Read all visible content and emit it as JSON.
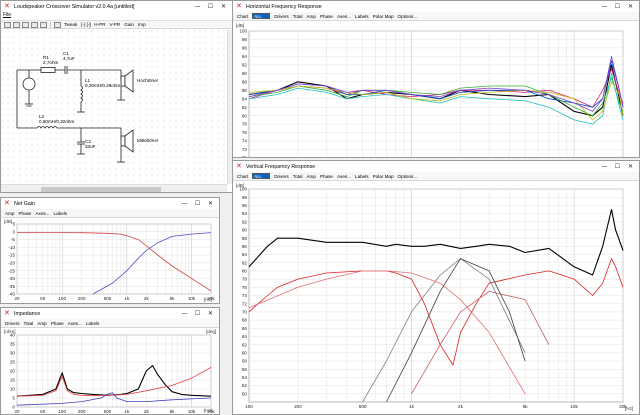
{
  "colors": {
    "accent": "#0b63c5",
    "title_icon": "#d4202a",
    "grid": "#d9d9d9",
    "axis_bg": "#ffffff"
  },
  "circuit_window": {
    "title": "Loudspeaker Crossover Simulator v2.0.4a [untitled]",
    "menu": "File",
    "toolbar": [
      "Tweak",
      "H-PR",
      "V-PR",
      "Gain",
      "Imp"
    ],
    "icons": [
      "new-icon",
      "open-icon",
      "save-icon",
      "undo-icon",
      "redo-icon",
      "tweak-icon"
    ],
    "components": {
      "r1": "R1",
      "r1_val": "2,7ohm",
      "c1": "C1",
      "c1_val": "4,7uF",
      "l1": "L1",
      "l1_val": "0,20mH/0,25ohm",
      "l2": "L2",
      "l2_val": "0,60mH/0,32ohm",
      "c2": "C2",
      "c2_val": "33uF",
      "tweeter": "Hochtöner",
      "mid": "Mitteltöner"
    }
  },
  "net_gain_window": {
    "title": "Net Gain",
    "tabs": [
      "Amp",
      "Phase",
      "Axes...",
      "Labels"
    ],
    "unit_left": "[dB]",
    "unit_bottom": "[Hz]"
  },
  "impedance_window": {
    "title": "Impedance",
    "tabs": [
      "Drivers",
      "Total",
      "Amp",
      "Phase",
      "Axes...",
      "Labels"
    ],
    "unit_left": "[ohm]",
    "unit_right": "[deg]",
    "unit_bottom": "[Hz]"
  },
  "hfr_window": {
    "title": "Horizontal Frequency Response",
    "toolbar": {
      "chart": "Chart",
      "select": "ALL",
      "items": [
        "Drivers",
        "Total",
        "Amp",
        "Phase",
        "Axes...",
        "Labels",
        "Polar Map",
        "Options..."
      ]
    },
    "unit_left": "[dB]"
  },
  "vfr_window": {
    "title": "Vertical Frequency Response",
    "toolbar": {
      "chart": "Chart",
      "select": "ALL",
      "items": [
        "Drivers",
        "Total",
        "Amp",
        "Phase",
        "Axes...",
        "Labels",
        "Polar Map",
        "Options..."
      ]
    },
    "unit_left": "[dB]",
    "unit_bottom": "[Hz]"
  },
  "chart_data": [
    {
      "id": "net_gain",
      "type": "line",
      "xscale": "log",
      "xlim": [
        20,
        20000
      ],
      "ylim": [
        -40,
        5
      ],
      "xticks": [
        "20",
        "50",
        "100",
        "200",
        "500",
        "1k",
        "2k",
        "5k",
        "10k",
        "20k"
      ],
      "yticks": [
        "5",
        "0",
        "-5",
        "-10",
        "-15",
        "-20",
        "-25",
        "-30",
        "-35",
        "-40"
      ],
      "series": [
        {
          "color": "#d04040",
          "x": [
            20,
            50,
            100,
            200,
            500,
            800,
            1000,
            1500,
            2000,
            3000,
            5000,
            10000,
            20000
          ],
          "y": [
            -0.5,
            -0.5,
            -0.5,
            -0.6,
            -1,
            -1.5,
            -2.5,
            -5,
            -9,
            -15,
            -22,
            -30,
            -38
          ]
        },
        {
          "color": "#5050c8",
          "x": [
            300,
            600,
            1000,
            1500,
            2000,
            3000,
            5000,
            10000,
            20000
          ],
          "y": [
            -40,
            -33,
            -25,
            -17,
            -12,
            -7,
            -3,
            -1.5,
            -0.5
          ]
        }
      ]
    },
    {
      "id": "impedance",
      "type": "line",
      "xscale": "log",
      "xlim": [
        20,
        20000
      ],
      "ylim": [
        0,
        40
      ],
      "xticks": [
        "20",
        "50",
        "100",
        "200",
        "500",
        "1k",
        "2k",
        "5k",
        "10k",
        "20k"
      ],
      "yticks": [
        "40",
        "35",
        "30",
        "25",
        "20",
        "15",
        "10",
        "5",
        "0"
      ],
      "series": [
        {
          "color": "#000000",
          "x": [
            20,
            50,
            80,
            100,
            120,
            150,
            200,
            300,
            500,
            800,
            1000,
            1500,
            2000,
            2500,
            3000,
            4000,
            5000,
            7000,
            10000,
            20000
          ],
          "y": [
            6,
            7,
            10,
            19,
            10,
            8,
            7.5,
            7,
            6.5,
            7,
            7.5,
            10,
            20,
            23,
            18,
            12,
            8.5,
            7,
            6.5,
            6
          ]
        },
        {
          "color": "#e04040",
          "x": [
            20,
            50,
            80,
            100,
            120,
            150,
            200,
            300,
            500,
            1000,
            2000,
            5000,
            10000,
            20000
          ],
          "y": [
            6,
            6.5,
            9,
            17,
            9,
            7,
            6.5,
            6.3,
            6.5,
            7,
            9,
            12,
            16,
            22
          ]
        },
        {
          "color": "#4040c0",
          "x": [
            20,
            100,
            200,
            400,
            500,
            600,
            700,
            1000,
            2000,
            5000,
            10000,
            20000
          ],
          "y": [
            1,
            2,
            3,
            5,
            7,
            8,
            5,
            3,
            3,
            4,
            4.5,
            5
          ]
        }
      ]
    },
    {
      "id": "horizontal_fr",
      "type": "line",
      "xscale": "log",
      "xlim": [
        100,
        20000
      ],
      "ylim": [
        70,
        100
      ],
      "yticks": [
        "100",
        "98",
        "96",
        "94",
        "92",
        "90",
        "88",
        "86",
        "84",
        "82",
        "80",
        "78",
        "76",
        "74",
        "72",
        "70"
      ],
      "series": [
        {
          "color": "#000000",
          "x": [
            100,
            150,
            200,
            300,
            400,
            500,
            700,
            1000,
            1500,
            2000,
            3000,
            5000,
            7000,
            10000,
            13000,
            15000,
            17000,
            19000,
            20000
          ],
          "y": [
            85,
            86,
            88,
            87,
            84,
            85,
            85.5,
            85,
            84,
            86,
            85,
            84.5,
            85,
            81,
            80,
            82,
            92,
            84,
            80
          ]
        },
        {
          "color": "#e0207a",
          "x": [
            100,
            150,
            200,
            300,
            400,
            500,
            700,
            1000,
            1500,
            2000,
            3000,
            5000,
            7000,
            10000,
            13000,
            15000,
            17000,
            19000,
            20000
          ],
          "y": [
            84,
            86,
            87,
            86.5,
            85,
            86,
            85,
            84.5,
            85,
            86,
            86,
            85.5,
            86,
            84,
            82,
            86,
            91,
            85,
            83
          ]
        },
        {
          "color": "#0050c0",
          "x": [
            100,
            150,
            200,
            300,
            400,
            500,
            700,
            1000,
            1500,
            2000,
            3000,
            5000,
            7000,
            10000,
            13000,
            15000,
            17000,
            19000,
            20000
          ],
          "y": [
            85,
            86,
            87.5,
            87,
            85,
            85,
            86,
            85,
            84,
            85.5,
            86,
            86,
            84,
            83,
            82,
            84,
            93,
            86,
            82
          ]
        },
        {
          "color": "#30b030",
          "x": [
            100,
            150,
            200,
            300,
            400,
            500,
            700,
            1000,
            1500,
            2000,
            3000,
            5000,
            7000,
            10000,
            13000,
            15000,
            17000,
            19000,
            20000
          ],
          "y": [
            84.5,
            85.5,
            87,
            86,
            84.5,
            86,
            86,
            85.5,
            85,
            86.5,
            87,
            87,
            85,
            82,
            80,
            83,
            89,
            83,
            81
          ]
        },
        {
          "color": "#20c0c0",
          "x": [
            100,
            150,
            200,
            300,
            400,
            500,
            700,
            1000,
            1500,
            2000,
            3000,
            5000,
            7000,
            10000,
            13000,
            15000,
            17000,
            19000,
            20000
          ],
          "y": [
            84,
            85,
            86.5,
            85.5,
            84,
            84.5,
            85,
            84,
            83,
            84.5,
            84,
            83.5,
            82,
            79,
            78,
            80,
            90,
            82,
            79
          ]
        },
        {
          "color": "#c0c020",
          "x": [
            100,
            150,
            200,
            300,
            400,
            500,
            700,
            1000,
            1500,
            2000,
            3000,
            5000,
            7000,
            10000,
            13000,
            15000,
            17000,
            19000,
            20000
          ],
          "y": [
            85.5,
            86,
            87,
            86.5,
            85.5,
            85,
            85.5,
            84,
            83.5,
            85,
            85.5,
            86,
            85.5,
            84,
            79,
            81,
            88,
            85,
            80
          ]
        },
        {
          "color": "#8040d0",
          "x": [
            100,
            150,
            200,
            300,
            400,
            500,
            700,
            1000,
            1500,
            2000,
            3000,
            5000,
            7000,
            10000,
            13000,
            15000,
            17000,
            19000,
            20000
          ],
          "y": [
            84.5,
            86,
            87.5,
            87,
            85.5,
            86,
            86,
            85,
            84.5,
            86,
            86.5,
            86,
            85,
            83,
            81,
            84,
            94,
            86,
            82
          ]
        }
      ]
    },
    {
      "id": "vertical_fr",
      "type": "line",
      "xscale": "log",
      "xlim": [
        100,
        20000
      ],
      "ylim": [
        48,
        100
      ],
      "xticks": [
        "100",
        "200",
        "500",
        "1k",
        "2k",
        "5k",
        "10k",
        "20k"
      ],
      "yticks": [
        "100",
        "98",
        "96",
        "94",
        "92",
        "90",
        "88",
        "86",
        "84",
        "82",
        "80",
        "78",
        "76",
        "74",
        "72",
        "70",
        "68",
        "66",
        "64",
        "62",
        "60",
        "58",
        "56",
        "54",
        "52",
        "50"
      ],
      "series": [
        {
          "color": "#000000",
          "x": [
            100,
            130,
            150,
            200,
            300,
            500,
            700,
            800,
            1000,
            1200,
            1500,
            2000,
            2500,
            3000,
            4000,
            5000,
            7000,
            10000,
            13000,
            15000,
            17000,
            18000,
            20000
          ],
          "y": [
            81,
            86,
            88,
            88,
            87,
            87,
            86,
            86.5,
            86,
            86,
            86.5,
            85.5,
            86,
            86.5,
            86,
            84.5,
            85.5,
            81,
            79,
            86,
            95,
            90,
            85
          ]
        },
        {
          "color": "#e02020",
          "x": [
            100,
            130,
            150,
            200,
            300,
            500,
            700,
            800,
            1000,
            1200,
            1500,
            1800,
            2000,
            2500,
            3000,
            5000,
            7000,
            10000,
            13000,
            15000,
            17000,
            18000,
            20000
          ],
          "y": [
            70,
            74,
            76,
            78,
            79.5,
            80,
            80,
            79.5,
            78,
            72,
            62,
            57,
            65,
            72,
            77,
            79,
            80,
            78,
            74,
            77,
            83,
            81,
            76
          ]
        },
        {
          "color": "#e07070",
          "x": [
            100,
            200,
            300,
            500,
            700,
            1000,
            1500,
            2000,
            3000,
            5000
          ],
          "y": [
            71,
            76,
            78,
            80,
            80,
            79.5,
            77,
            73,
            65,
            50
          ]
        },
        {
          "color": "#808080",
          "x": [
            500,
            700,
            1000,
            1500,
            2000,
            3000,
            5000
          ],
          "y": [
            48,
            58,
            70,
            79,
            83,
            78,
            60
          ]
        },
        {
          "color": "#404040",
          "x": [
            700,
            1000,
            1500,
            2000,
            3000,
            4000,
            5000
          ],
          "y": [
            48,
            60,
            75,
            83,
            80,
            70,
            58
          ]
        },
        {
          "color": "#c06060",
          "x": [
            1000,
            1500,
            2000,
            3000,
            5000,
            7000
          ],
          "y": [
            50,
            62,
            70,
            75,
            73,
            62
          ]
        }
      ]
    }
  ]
}
